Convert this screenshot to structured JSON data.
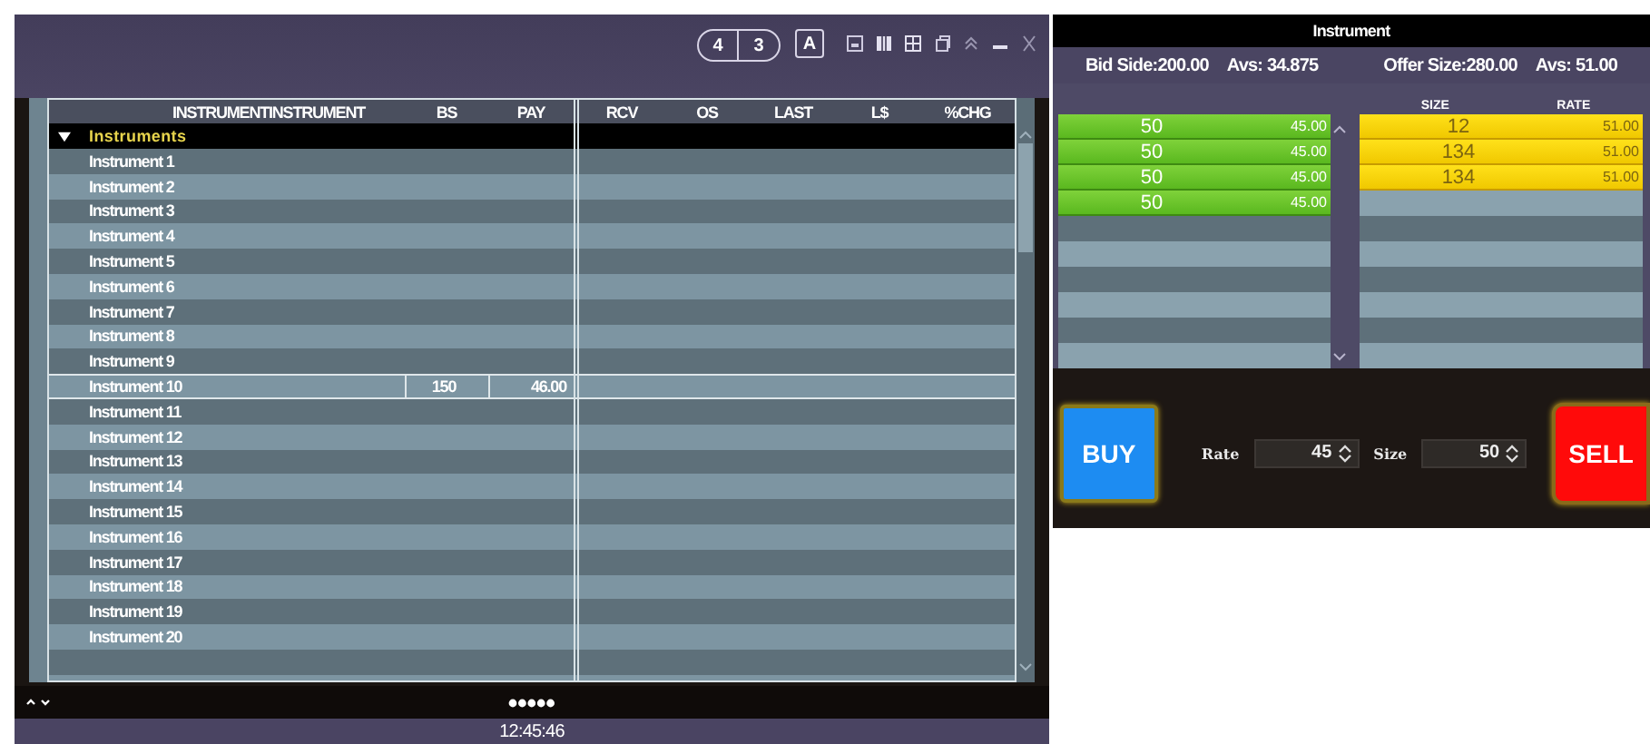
{
  "watchlist": {
    "toolbar": {
      "segment_buttons": [
        {
          "label": "4"
        },
        {
          "label": "3"
        }
      ],
      "mode_button": {
        "label": "A"
      }
    },
    "columns": [
      "INSTRUMENTINSTRUMENT",
      "BS",
      "PAY",
      "RCV",
      "OS",
      "LAST",
      "L$",
      "%CHG"
    ],
    "groups": [
      {
        "label": "Instruments",
        "expanded": true,
        "children": [
          {
            "name": "Instrument 1",
            "selected": false
          },
          {
            "name": "Instrument 2",
            "selected": false
          },
          {
            "name": "Instrument 3",
            "selected": false
          },
          {
            "name": "Instrument 4",
            "selected": false
          },
          {
            "name": "Instrument 5",
            "selected": false
          },
          {
            "name": "Instrument 6",
            "selected": false
          },
          {
            "name": "Instrument 7",
            "selected": false
          },
          {
            "name": "Instrument 8",
            "selected": false
          },
          {
            "name": "Instrument 9",
            "selected": false
          },
          {
            "name": "Instrument 10",
            "selected": true,
            "cells": [
              "150",
              "46.00"
            ]
          },
          {
            "name": "Instrument 11",
            "selected": false
          },
          {
            "name": "Instrument 12",
            "selected": false
          },
          {
            "name": "Instrument 13",
            "selected": false
          },
          {
            "name": "Instrument 14",
            "selected": false
          },
          {
            "name": "Instrument 15",
            "selected": false
          },
          {
            "name": "Instrument 16",
            "selected": false
          },
          {
            "name": "Instrument 17",
            "selected": false
          },
          {
            "name": "Instrument 18",
            "selected": false
          },
          {
            "name": "Instrument 19",
            "selected": false
          },
          {
            "name": "Instrument 20",
            "selected": false
          }
        ]
      }
    ],
    "status_time": "12:45:46"
  },
  "order_book": {
    "title": "Instrument",
    "bid_summary": {
      "side": "Bid Side:200.00",
      "avg": "Avs: 34.875"
    },
    "offer_summary": {
      "side": "Offer Size:280.00",
      "avg": "Avs: 51.00"
    },
    "offer_columns": [
      "SIZE",
      "RATE"
    ],
    "bids": [
      {
        "size": "50",
        "rate": "45.00"
      },
      {
        "size": "50",
        "rate": "45.00"
      },
      {
        "size": "50",
        "rate": "45.00"
      },
      {
        "size": "50",
        "rate": "45.00"
      }
    ],
    "offers": [
      {
        "size": "12",
        "rate": "51.00"
      },
      {
        "size": "134",
        "rate": "51.00"
      },
      {
        "size": "134",
        "rate": "51.00"
      }
    ],
    "entry": {
      "buy_label": "BUY",
      "rate_label": "Rate",
      "rate_value": "45",
      "size_label": "Size",
      "size_value": "50",
      "sell_label": "SELL"
    }
  }
}
